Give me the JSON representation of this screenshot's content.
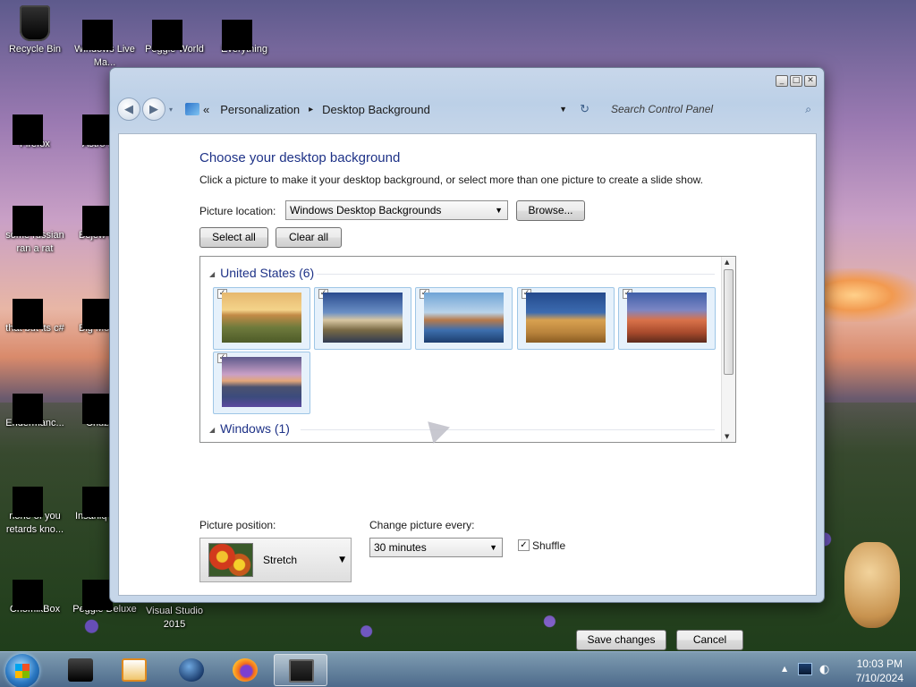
{
  "desktop": {
    "icons": [
      {
        "label": "Recycle Bin"
      },
      {
        "label": "Windows Live Ma..."
      },
      {
        "label": "Peggle World"
      },
      {
        "label": "Everything"
      },
      {
        "label": "Firefox"
      },
      {
        "label": "Astro Delu..."
      },
      {
        "label": "some russian ran a rat"
      },
      {
        "label": "Bejew Delu..."
      },
      {
        "label": "that but its c#"
      },
      {
        "label": "Big Mo Delu..."
      },
      {
        "label": "Endermanc..."
      },
      {
        "label": "Chuz Delu..."
      },
      {
        "label": "none of you retards kno..."
      },
      {
        "label": "Insaniq Delu..."
      },
      {
        "label": "ChomikBox"
      },
      {
        "label": "Peggle Deluxe"
      },
      {
        "label": "Visual Studio 2015"
      }
    ]
  },
  "window": {
    "breadcrumb": [
      "Personalization",
      "Desktop Background"
    ],
    "breadcrumb_overflow": "«",
    "search_placeholder": "Search Control Panel",
    "caption_buttons": [
      "_",
      "□",
      "✕"
    ],
    "heading": "Choose your desktop background",
    "description": "Click a picture to make it your desktop background, or select more than one picture to create a slide show.",
    "picture_location_label": "Picture location:",
    "picture_location_value": "Windows Desktop Backgrounds",
    "browse_label": "Browse...",
    "select_all_label": "Select all",
    "clear_all_label": "Clear all",
    "groups": [
      {
        "name": "United States (6)",
        "count": 6,
        "checked": true
      },
      {
        "name": "Windows (1)",
        "count": 1,
        "checked": true
      }
    ],
    "picture_position_label": "Picture position:",
    "picture_position_value": "Stretch",
    "change_picture_label": "Change picture every:",
    "change_picture_value": "30 minutes",
    "shuffle_label": "Shuffle",
    "shuffle_checked": true,
    "save_label": "Save changes",
    "cancel_label": "Cancel"
  },
  "taskbar": {
    "time": "10:03 PM",
    "date": "7/10/2024"
  }
}
